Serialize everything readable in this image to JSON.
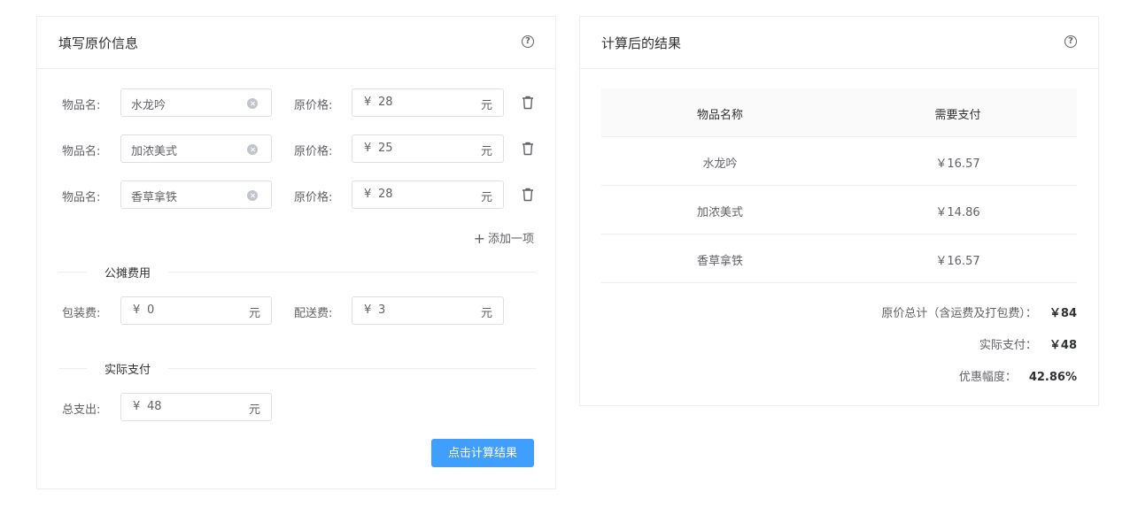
{
  "left": {
    "title": "填写原价信息",
    "items": [
      {
        "name_label": "物品名:",
        "name_value": "水龙吟",
        "price_label": "原价格:",
        "currency": "¥",
        "price": "28",
        "unit": "元"
      },
      {
        "name_label": "物品名:",
        "name_value": "加浓美式",
        "price_label": "原价格:",
        "currency": "¥",
        "price": "25",
        "unit": "元"
      },
      {
        "name_label": "物品名:",
        "name_value": "香草拿铁",
        "price_label": "原价格:",
        "currency": "¥",
        "price": "28",
        "unit": "元"
      }
    ],
    "add_item_label": "添加一项",
    "shared_section": "公摊费用",
    "packaging": {
      "label": "包装费:",
      "currency": "¥",
      "value": "0",
      "unit": "元"
    },
    "delivery": {
      "label": "配送费:",
      "currency": "¥",
      "value": "3",
      "unit": "元"
    },
    "actual_section": "实际支付",
    "total": {
      "label": "总支出:",
      "currency": "¥",
      "value": "48",
      "unit": "元"
    },
    "calculate_button": "点击计算结果"
  },
  "right": {
    "title": "计算后的结果",
    "table": {
      "headers": [
        "物品名称",
        "需要支付"
      ],
      "rows": [
        [
          "水龙吟",
          "￥16.57"
        ],
        [
          "加浓美式",
          "￥14.86"
        ],
        [
          "香草拿铁",
          "￥16.57"
        ]
      ]
    },
    "summary": {
      "original_total_label": "原价总计（含运费及打包费）：",
      "original_total_value": "￥84",
      "actual_pay_label": "实际支付：",
      "actual_pay_value": "￥48",
      "discount_label": "优惠幅度：",
      "discount_value": "42.86%"
    }
  },
  "icons": {
    "help": "question-circle-icon",
    "delete": "trash-icon",
    "clear": "close-circle-icon",
    "add": "plus-icon"
  },
  "colors": {
    "primary": "#409eff",
    "border": "#dcdfe6",
    "text": "#606266",
    "heading": "#303133"
  }
}
